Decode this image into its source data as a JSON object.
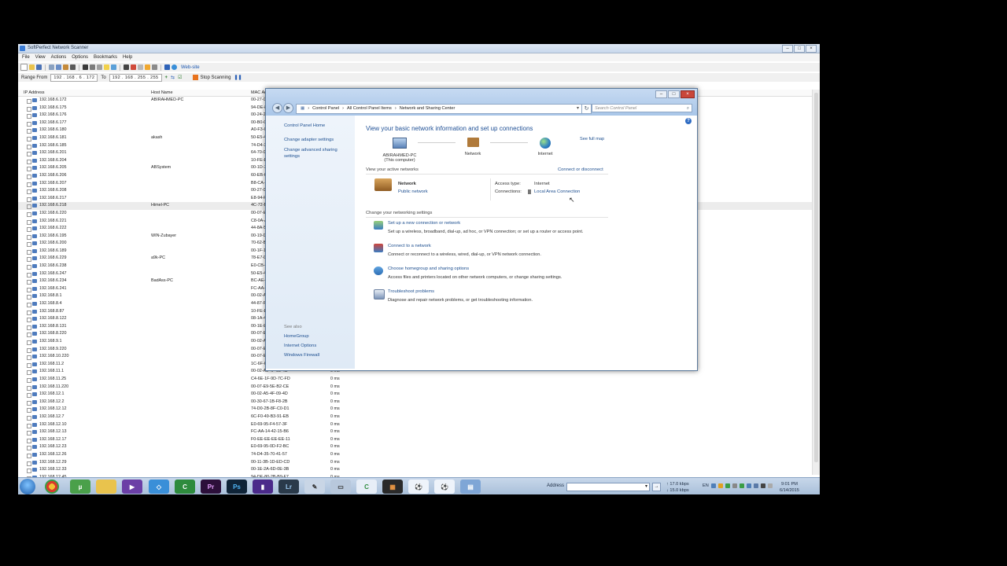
{
  "scanner": {
    "title": "SoftPerfect Network Scanner",
    "menu": [
      "File",
      "View",
      "Actions",
      "Options",
      "Bookmarks",
      "Help"
    ],
    "website_label": "Web-site",
    "range_from_label": "Range From",
    "range_from": "192 . 168 . 6 . 172",
    "range_to_label": "To",
    "range_to": "192 . 168 . 255 . 255",
    "stop_label": "Stop Scanning",
    "columns": {
      "ip": "IP Address",
      "host": "Host Name",
      "mac": "MAC Add"
    },
    "rows": [
      {
        "ip": "192.168.6.172",
        "host": "ABIRAHMED-PC",
        "mac": "00-27-0",
        "ms": ""
      },
      {
        "ip": "192.168.6.175",
        "host": "",
        "mac": "94-DE-8",
        "ms": ""
      },
      {
        "ip": "192.168.6.176",
        "host": "",
        "mac": "00-24-2",
        "ms": ""
      },
      {
        "ip": "192.168.6.177",
        "host": "",
        "mac": "00-B0-C",
        "ms": ""
      },
      {
        "ip": "192.168.6.180",
        "host": "",
        "mac": "A0-F3-C",
        "ms": ""
      },
      {
        "ip": "192.168.6.181",
        "host": "akash",
        "mac": "50-E5-4",
        "ms": ""
      },
      {
        "ip": "192.168.6.185",
        "host": "",
        "mac": "74-D4-3",
        "ms": ""
      },
      {
        "ip": "192.168.6.201",
        "host": "",
        "mac": "64-70-0",
        "ms": ""
      },
      {
        "ip": "192.168.6.204",
        "host": "",
        "mac": "10-FE-E",
        "ms": ""
      },
      {
        "ip": "192.168.6.205",
        "host": "ABSystem",
        "mac": "00-1D-7",
        "ms": ""
      },
      {
        "ip": "192.168.6.206",
        "host": "",
        "mac": "60-EB-6",
        "ms": ""
      },
      {
        "ip": "192.168.6.207",
        "host": "",
        "mac": "B8-CA-3",
        "ms": ""
      },
      {
        "ip": "192.168.6.208",
        "host": "",
        "mac": "00-27-0",
        "ms": ""
      },
      {
        "ip": "192.168.6.217",
        "host": "",
        "mac": "E8-94-F",
        "ms": ""
      },
      {
        "ip": "192.168.6.218",
        "host": "Himel-PC",
        "mac": "4C-72-B",
        "ms": ""
      },
      {
        "ip": "192.168.6.220",
        "host": "",
        "mac": "00-07-E",
        "ms": ""
      },
      {
        "ip": "192.168.6.221",
        "host": "",
        "mac": "C8-0A-A",
        "ms": ""
      },
      {
        "ip": "192.168.6.222",
        "host": "",
        "mac": "44-8A-5",
        "ms": ""
      },
      {
        "ip": "192.168.6.195",
        "host": "WIN-Zubayer",
        "mac": "00-19-D",
        "ms": ""
      },
      {
        "ip": "192.168.6.200",
        "host": "",
        "mac": "70-62-B",
        "ms": ""
      },
      {
        "ip": "192.168.6.189",
        "host": "",
        "mac": "00-1F-1",
        "ms": ""
      },
      {
        "ip": "192.168.6.229",
        "host": "a9k-PC",
        "mac": "78-E7-D",
        "ms": ""
      },
      {
        "ip": "192.168.6.238",
        "host": "",
        "mac": "E0-CB-4",
        "ms": ""
      },
      {
        "ip": "192.168.6.247",
        "host": "",
        "mac": "50-E5-4",
        "ms": ""
      },
      {
        "ip": "192.168.6.234",
        "host": "BadAss-PC",
        "mac": "BC-AE-C",
        "ms": ""
      },
      {
        "ip": "192.168.6.241",
        "host": "",
        "mac": "FC-AA-1",
        "ms": ""
      },
      {
        "ip": "192.168.8.1",
        "host": "",
        "mac": "00-02-A",
        "ms": ""
      },
      {
        "ip": "192.168.8.4",
        "host": "",
        "mac": "44-87-F",
        "ms": ""
      },
      {
        "ip": "192.168.8.87",
        "host": "",
        "mac": "10-FE-E",
        "ms": ""
      },
      {
        "ip": "192.168.8.122",
        "host": "",
        "mac": "08-1A-4",
        "ms": ""
      },
      {
        "ip": "192.168.8.131",
        "host": "",
        "mac": "00-1E-E",
        "ms": ""
      },
      {
        "ip": "192.168.8.220",
        "host": "",
        "mac": "00-07-E",
        "ms": ""
      },
      {
        "ip": "192.168.9.1",
        "host": "",
        "mac": "00-02-A",
        "ms": ""
      },
      {
        "ip": "192.168.9.220",
        "host": "",
        "mac": "00-07-E",
        "ms": ""
      },
      {
        "ip": "192.168.10.220",
        "host": "",
        "mac": "00-07-E",
        "ms": ""
      },
      {
        "ip": "192.168.11.2",
        "host": "",
        "mac": "1C-6F-6",
        "ms": ""
      },
      {
        "ip": "192.168.11.1",
        "host": "",
        "mac": "00-02-A5-4F-09-4D",
        "ms": "0 ms"
      },
      {
        "ip": "192.168.11.25",
        "host": "",
        "mac": "C4-6E-1F-9D-7C-FD",
        "ms": "0 ms"
      },
      {
        "ip": "192.168.11.220",
        "host": "",
        "mac": "00-07-E9-5E-B2-CE",
        "ms": "0 ms"
      },
      {
        "ip": "192.168.12.1",
        "host": "",
        "mac": "00-02-A5-4F-09-4D",
        "ms": "0 ms"
      },
      {
        "ip": "192.168.12.2",
        "host": "",
        "mac": "00-30-67-1B-F8-2B",
        "ms": "0 ms"
      },
      {
        "ip": "192.168.12.12",
        "host": "",
        "mac": "74-D0-2B-8F-C0-D1",
        "ms": "0 ms"
      },
      {
        "ip": "192.168.12.7",
        "host": "",
        "mac": "6C-F0-49-B3-91-EB",
        "ms": "0 ms"
      },
      {
        "ip": "192.168.12.10",
        "host": "",
        "mac": "E0-69-95-F4-57-3F",
        "ms": "0 ms"
      },
      {
        "ip": "192.168.12.13",
        "host": "",
        "mac": "FC-AA-14-42-15-B6",
        "ms": "0 ms"
      },
      {
        "ip": "192.168.12.17",
        "host": "",
        "mac": "F0-EE-EE-EE-EE-11",
        "ms": "0 ms"
      },
      {
        "ip": "192.168.12.23",
        "host": "",
        "mac": "E0-69-95-0D-F2-BC",
        "ms": "0 ms"
      },
      {
        "ip": "192.168.12.26",
        "host": "",
        "mac": "74-D4-35-70-41-57",
        "ms": "0 ms"
      },
      {
        "ip": "192.168.12.29",
        "host": "",
        "mac": "00-11-3B-1D-ED-CD",
        "ms": "0 ms"
      },
      {
        "ip": "192.168.12.33",
        "host": "",
        "mac": "00-1E-2A-6D-0E-3B",
        "ms": "0 ms"
      },
      {
        "ip": "192.168.12.45",
        "host": "",
        "mac": "94-DE-80-2B-B9-F7",
        "ms": "0 ms"
      }
    ]
  },
  "nsc": {
    "breadcrumbs": [
      "Control Panel",
      "All Control Panel Items",
      "Network and Sharing Center"
    ],
    "search_placeholder": "Search Control Panel",
    "sidebar": {
      "home": "Control Panel Home",
      "adapter": "Change adapter settings",
      "advanced1": "Change advanced sharing",
      "advanced2": "settings",
      "see_also": "See also",
      "homegroup": "HomeGroup",
      "internet_options": "Internet Options",
      "firewall": "Windows Firewall"
    },
    "heading": "View your basic network information and set up connections",
    "see_full_map": "See full map",
    "map": {
      "computer": "ABIRAHMED-PC",
      "computer_sub": "(This computer)",
      "network": "Network",
      "internet": "Internet"
    },
    "active_networks_label": "View your active networks",
    "connect_disconnect": "Connect or disconnect",
    "active": {
      "name": "Network",
      "type": "Public network",
      "access_type_label": "Access type:",
      "access_type": "Internet",
      "connections_label": "Connections:",
      "connection": "Local Area Connection"
    },
    "change_settings_label": "Change your networking settings",
    "tasks": [
      {
        "title": "Set up a new connection or network",
        "desc": "Set up a wireless, broadband, dial-up, ad hoc, or VPN connection; or set up a router or access point."
      },
      {
        "title": "Connect to a network",
        "desc": "Connect or reconnect to a wireless, wired, dial-up, or VPN network connection."
      },
      {
        "title": "Choose homegroup and sharing options",
        "desc": "Access files and printers located on other network computers, or change sharing settings."
      },
      {
        "title": "Troubleshoot problems",
        "desc": "Diagnose and repair network problems, or get troubleshooting information."
      }
    ]
  },
  "taskbar": {
    "address_label": "Address",
    "speed_up": "17.0 kbps",
    "speed_down": "15.0 kbps",
    "lang": "EN",
    "time": "9:01 PM",
    "date": "6/14/2015",
    "apps": [
      "Pr",
      "Ps",
      "Lr"
    ]
  }
}
